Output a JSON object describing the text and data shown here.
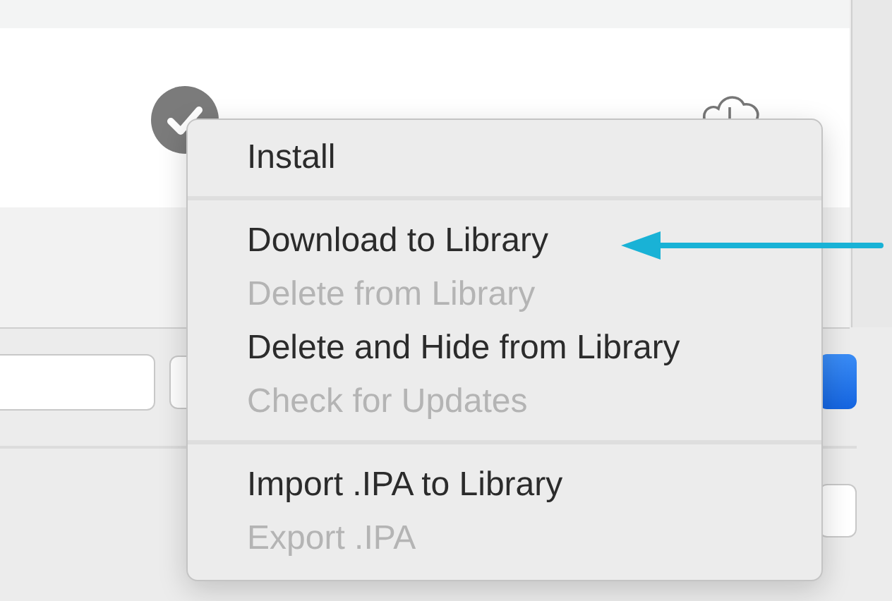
{
  "menu": {
    "sections": [
      [
        {
          "label": "Install",
          "disabled": false
        }
      ],
      [
        {
          "label": "Download to Library",
          "disabled": false
        },
        {
          "label": "Delete from Library",
          "disabled": true
        },
        {
          "label": "Delete and Hide from Library",
          "disabled": false
        },
        {
          "label": "Check for Updates",
          "disabled": true
        }
      ],
      [
        {
          "label": "Import .IPA to Library",
          "disabled": false
        },
        {
          "label": "Export .IPA",
          "disabled": true
        }
      ]
    ]
  }
}
